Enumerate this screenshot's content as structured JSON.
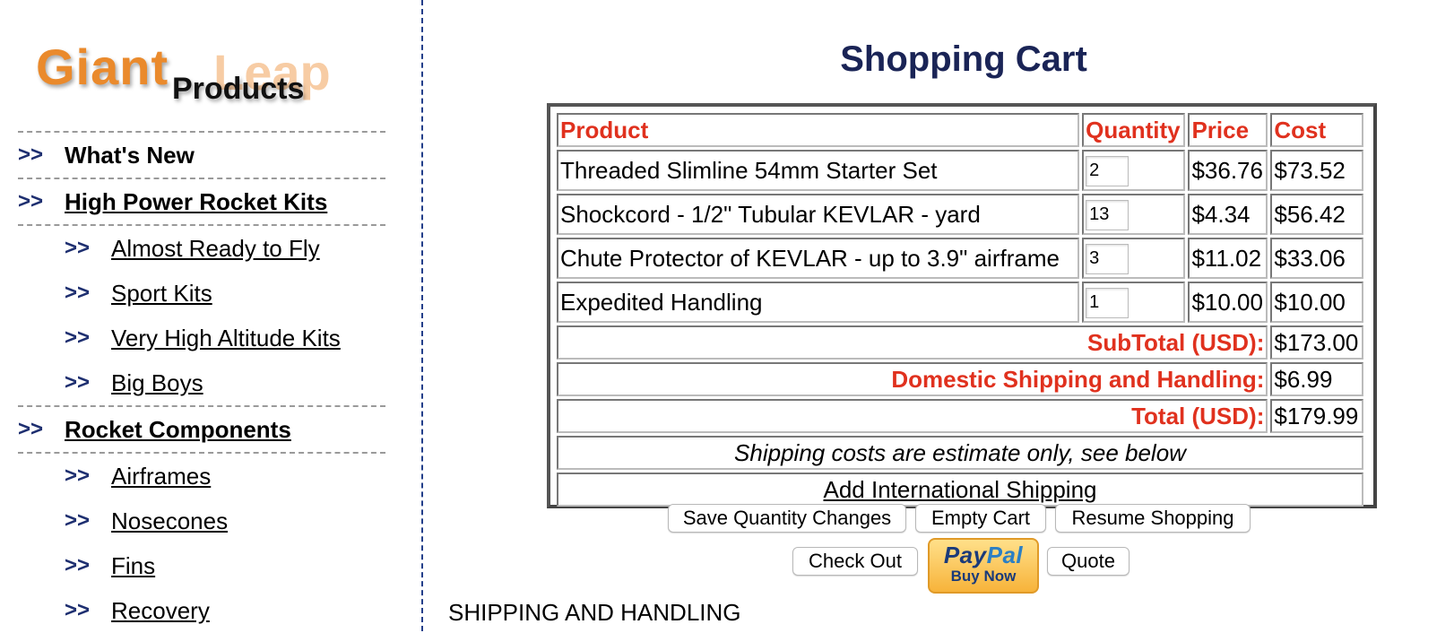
{
  "logo": {
    "text_giant": "Giant",
    "text_leap": "Leap",
    "text_products": "Products"
  },
  "sidebar": {
    "items": [
      {
        "arrow": ">>",
        "label": "What's New",
        "level": "top",
        "link": false
      },
      {
        "arrow": ">>",
        "label": "High Power Rocket Kits",
        "level": "top",
        "link": true
      },
      {
        "arrow": ">>",
        "label": "Almost Ready to Fly",
        "level": "sub",
        "link": true
      },
      {
        "arrow": ">>",
        "label": "Sport Kits",
        "level": "sub",
        "link": true
      },
      {
        "arrow": ">>",
        "label": "Very High Altitude Kits",
        "level": "sub",
        "link": true
      },
      {
        "arrow": ">>",
        "label": "Big Boys",
        "level": "sub",
        "link": true
      },
      {
        "arrow": ">>",
        "label": "Rocket Components",
        "level": "top",
        "link": true
      },
      {
        "arrow": ">>",
        "label": "Airframes",
        "level": "sub",
        "link": true
      },
      {
        "arrow": ">>",
        "label": "Nosecones",
        "level": "sub",
        "link": true
      },
      {
        "arrow": ">>",
        "label": "Fins",
        "level": "sub",
        "link": true
      },
      {
        "arrow": ">>",
        "label": "Recovery",
        "level": "sub",
        "link": true
      }
    ]
  },
  "main": {
    "title": "Shopping Cart",
    "cart": {
      "headers": {
        "product": "Product",
        "quantity": "Quantity",
        "price": "Price",
        "cost": "Cost"
      },
      "rows": [
        {
          "product": "Threaded Slimline 54mm Starter Set",
          "quantity": "2",
          "price": "$36.76",
          "cost": "$73.52"
        },
        {
          "product": "Shockcord - 1/2\" Tubular KEVLAR - yard",
          "quantity": "13",
          "price": "$4.34",
          "cost": "$56.42"
        },
        {
          "product": "Chute Protector of KEVLAR - up to 3.9\" airframe",
          "quantity": "3",
          "price": "$11.02",
          "cost": "$33.06"
        },
        {
          "product": "Expedited Handling",
          "quantity": "1",
          "price": "$10.00",
          "cost": "$10.00"
        }
      ],
      "subtotal": {
        "label": "SubTotal (USD):",
        "value": "$173.00"
      },
      "shipping": {
        "label": "Domestic Shipping and Handling:",
        "value": "$6.99"
      },
      "total": {
        "label": "Total (USD):",
        "value": "$179.99"
      },
      "note": "Shipping costs are estimate only, see below",
      "international_link": "Add International Shipping"
    },
    "buttons": {
      "save": "Save Quantity Changes",
      "empty": "Empty Cart",
      "resume": "Resume Shopping",
      "checkout": "Check Out",
      "quote": "Quote"
    },
    "paypal": {
      "brand_pay": "Pay",
      "brand_pal": "Pal",
      "sub": "Buy Now"
    },
    "shipping_heading": "SHIPPING AND HANDLING"
  }
}
